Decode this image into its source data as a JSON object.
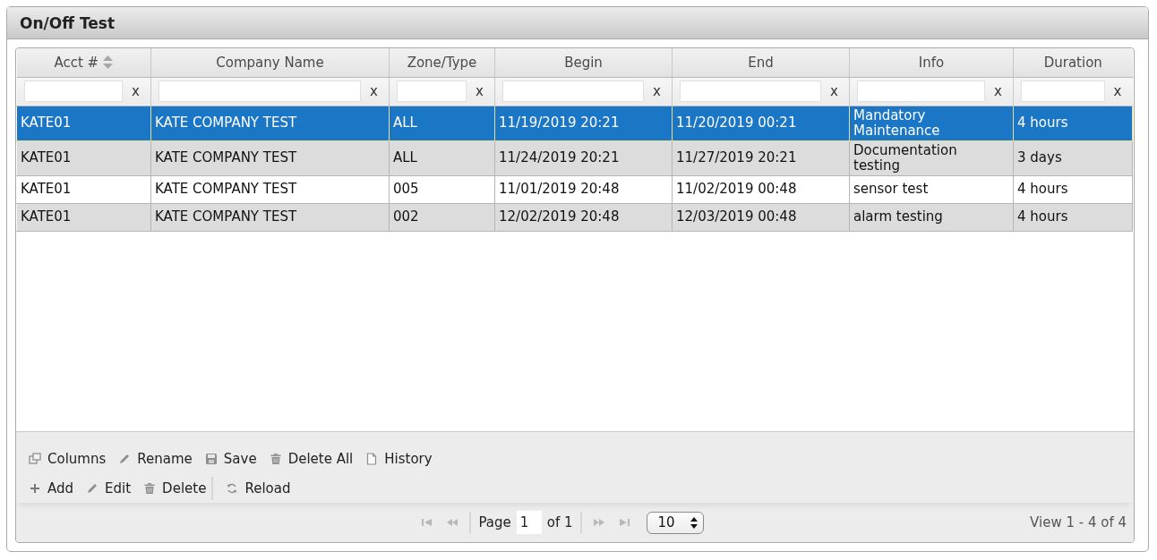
{
  "panel": {
    "title": "On/Off Test"
  },
  "table": {
    "columns": [
      {
        "label": "Acct #",
        "sort_indicator": true,
        "filter_clear": "x"
      },
      {
        "label": "Company Name",
        "sort_indicator": false,
        "filter_clear": "x"
      },
      {
        "label": "Zone/Type",
        "sort_indicator": false,
        "filter_clear": "x"
      },
      {
        "label": "Begin",
        "sort_indicator": false,
        "filter_clear": "x"
      },
      {
        "label": "End",
        "sort_indicator": false,
        "filter_clear": "x"
      },
      {
        "label": "Info",
        "sort_indicator": false,
        "filter_clear": "x"
      },
      {
        "label": "Duration",
        "sort_indicator": false,
        "filter_clear": "x"
      }
    ],
    "rows": [
      {
        "selected": true,
        "cells": [
          "KATE01",
          "KATE COMPANY TEST",
          "ALL",
          "11/19/2019 20:21",
          "11/20/2019 00:21",
          "Mandatory Maintenance",
          "4 hours"
        ]
      },
      {
        "selected": false,
        "cells": [
          "KATE01",
          "KATE COMPANY TEST",
          "ALL",
          "11/24/2019 20:21",
          "11/27/2019 20:21",
          "Documentation testing",
          "3 days"
        ]
      },
      {
        "selected": false,
        "cells": [
          "KATE01",
          "KATE COMPANY TEST",
          "005",
          "11/01/2019 20:48",
          "11/02/2019 00:48",
          "sensor test",
          "4 hours"
        ]
      },
      {
        "selected": false,
        "cells": [
          "KATE01",
          "KATE COMPANY TEST",
          "002",
          "12/02/2019 20:48",
          "12/03/2019 00:48",
          "alarm testing",
          "4 hours"
        ]
      }
    ]
  },
  "toolbars": [
    {
      "groups": [
        [
          {
            "kind": "columns",
            "label": "Columns"
          },
          {
            "kind": "rename",
            "label": "Rename"
          },
          {
            "kind": "save",
            "label": "Save"
          },
          {
            "kind": "delete_all",
            "label": "Delete All"
          },
          {
            "kind": "history",
            "label": "History"
          }
        ]
      ]
    },
    {
      "groups": [
        [
          {
            "kind": "add",
            "label": "Add"
          },
          {
            "kind": "edit",
            "label": "Edit"
          },
          {
            "kind": "delete",
            "label": "Delete"
          }
        ],
        [
          {
            "kind": "reload",
            "label": "Reload"
          }
        ]
      ]
    }
  ],
  "pager": {
    "nav_back": [
      {
        "kind": "first",
        "disabled": true
      },
      {
        "kind": "prev",
        "disabled": true
      }
    ],
    "page_label": "Page",
    "page_value": "1",
    "of_label": "of 1",
    "nav_forward": [
      {
        "kind": "next",
        "disabled": true
      },
      {
        "kind": "last",
        "disabled": true
      }
    ],
    "page_size": "10",
    "view_info": "View 1 - 4 of 4"
  }
}
